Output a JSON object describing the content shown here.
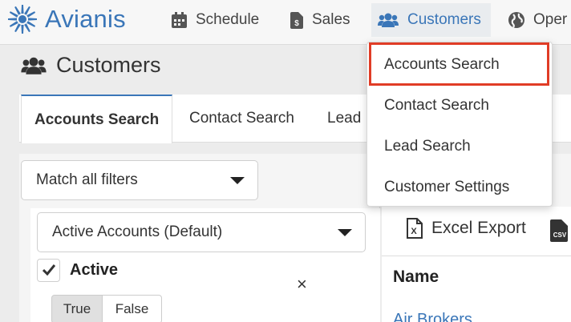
{
  "app": {
    "brand": "Avianis"
  },
  "nav": {
    "items": [
      {
        "label": "Schedule",
        "icon": "calendar-icon"
      },
      {
        "label": "Sales",
        "icon": "invoice-dollar-icon"
      },
      {
        "label": "Customers",
        "icon": "users-icon",
        "active": true
      },
      {
        "label": "Oper",
        "icon": "globe-icon"
      }
    ]
  },
  "page": {
    "title": "Customers",
    "icon": "users-icon"
  },
  "tabs": [
    {
      "label": "Accounts Search",
      "active": true
    },
    {
      "label": "Contact Search"
    },
    {
      "label": "Lead"
    }
  ],
  "filters": {
    "match_select": "Match all filters",
    "preset_select": "Active Accounts (Default)",
    "active_filter": {
      "label": "Active",
      "checked": true,
      "remove_symbol": "×",
      "options": [
        "True",
        "False"
      ],
      "selected": "True"
    }
  },
  "results": {
    "export_label": "Excel Export",
    "export_icon": "excel-file-icon",
    "csv_icon": "csv-file-icon",
    "column_header": "Name",
    "first_row": "Air Brokers"
  },
  "dropdown": {
    "items": [
      "Accounts Search",
      "Contact Search",
      "Lead Search",
      "Customer Settings"
    ],
    "highlighted_index": 0,
    "highlight_color": "#e03c26"
  },
  "colors": {
    "brand": "#3a76b8",
    "link": "#3a76b8",
    "active_tab_border": "#3a76b8"
  }
}
